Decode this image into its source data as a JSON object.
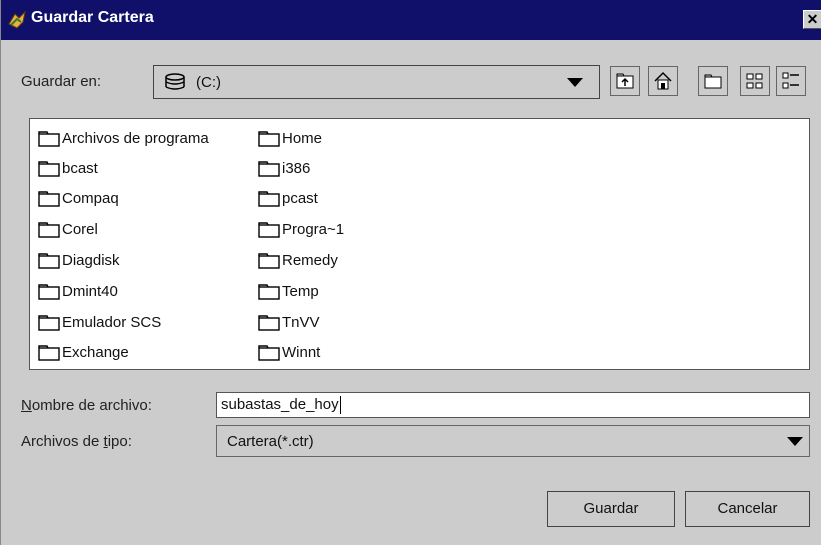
{
  "window": {
    "title": "Guardar Cartera",
    "close_glyph": "✕",
    "icon": "app-logo-icon"
  },
  "look_in": {
    "label": "Guardar en:",
    "value": "(C:)",
    "icon": "hard-drive-icon"
  },
  "toolbar": {
    "buttons": [
      "up-one-level-icon",
      "home-icon",
      "new-folder-icon",
      "list-view-icon",
      "details-view-icon"
    ]
  },
  "files": {
    "col1": [
      "Archivos de programa",
      "bcast",
      "Compaq",
      "Corel",
      "Diagdisk",
      "Dmint40",
      "Emulador SCS",
      "Exchange"
    ],
    "col2": [
      "Home",
      "i386",
      "pcast",
      "Progra~1",
      "Remedy",
      "Temp",
      "TnVV",
      "Winnt"
    ]
  },
  "filename": {
    "label_prefix": "N",
    "label_rest": "ombre de archivo:",
    "value": "subastas_de_hoy"
  },
  "filetype": {
    "label_prefix": "Archivos de ",
    "label_mnemonic": "t",
    "label_rest": "ipo:",
    "value": "Cartera(*.ctr)"
  },
  "buttons": {
    "save_label": "Guardar",
    "cancel_label": "Cancelar"
  },
  "colors": {
    "titlebar": "#10106b",
    "dialog_bg": "#cccccc",
    "list_bg": "#ffffff"
  }
}
